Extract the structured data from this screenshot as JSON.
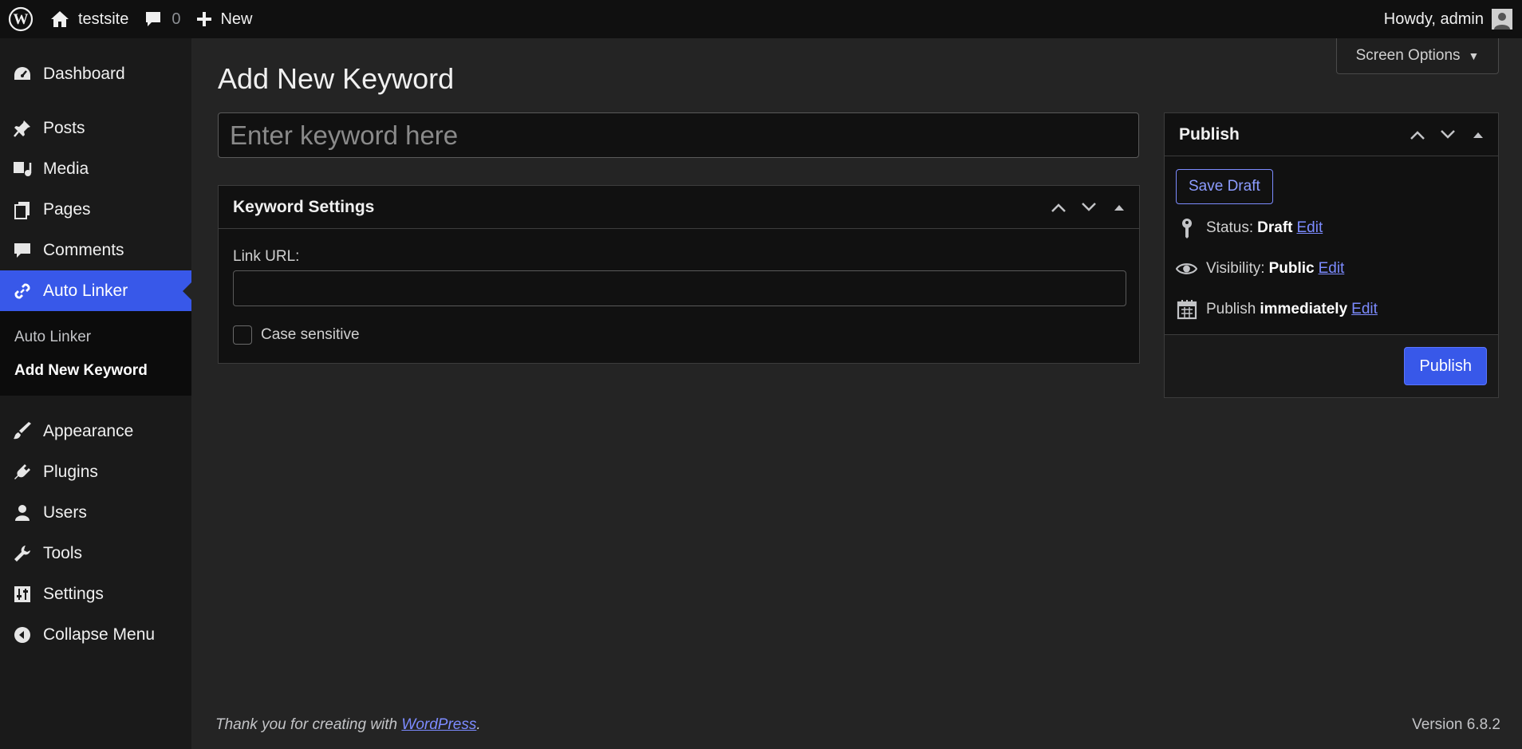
{
  "adminbar": {
    "site_name": "testsite",
    "comments_count": "0",
    "new_label": "New",
    "howdy": "Howdy, admin"
  },
  "sidebar": {
    "items": [
      {
        "label": "Dashboard",
        "icon": "dashboard-icon"
      },
      {
        "label": "Posts",
        "icon": "pin-icon"
      },
      {
        "label": "Media",
        "icon": "media-icon"
      },
      {
        "label": "Pages",
        "icon": "pages-icon"
      },
      {
        "label": "Comments",
        "icon": "comment-icon"
      },
      {
        "label": "Auto Linker",
        "icon": "link-icon"
      },
      {
        "label": "Appearance",
        "icon": "brush-icon"
      },
      {
        "label": "Plugins",
        "icon": "plug-icon"
      },
      {
        "label": "Users",
        "icon": "user-icon"
      },
      {
        "label": "Tools",
        "icon": "wrench-icon"
      },
      {
        "label": "Settings",
        "icon": "sliders-icon"
      },
      {
        "label": "Collapse Menu",
        "icon": "collapse-icon"
      }
    ],
    "submenu": [
      "Auto Linker",
      "Add New Keyword"
    ]
  },
  "screen_options": "Screen Options",
  "page_title": "Add New Keyword",
  "keyword_placeholder": "Enter keyword here",
  "keyword_settings": {
    "title": "Keyword Settings",
    "link_label": "Link URL:",
    "link_value": "",
    "case_label": "Case sensitive"
  },
  "publish": {
    "title": "Publish",
    "save_draft": "Save Draft",
    "status_label": "Status:",
    "status_value": "Draft",
    "visibility_label": "Visibility:",
    "visibility_value": "Public",
    "publish_label": "Publish",
    "publish_value": "immediately",
    "edit": "Edit",
    "button": "Publish"
  },
  "footer": {
    "thanks_prefix": "Thank you for creating with ",
    "wordpress_link": "WordPress",
    "thanks_suffix": ".",
    "version": "Version 6.8.2"
  },
  "colors": {
    "accent": "#3858e9",
    "link": "#7c8bff",
    "background": "#242424",
    "sidebar": "#1a1a1a"
  }
}
